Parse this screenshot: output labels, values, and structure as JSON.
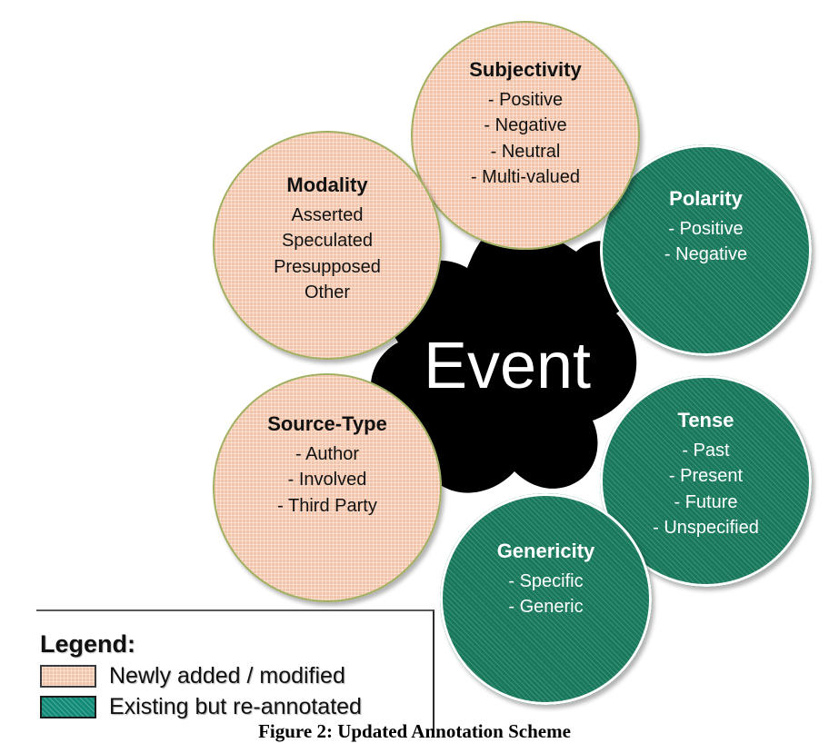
{
  "figure": {
    "center_label": "Event",
    "caption": "Figure 2: Updated Annotation Scheme"
  },
  "colors": {
    "pink_fill": "#f3c3a8",
    "pink_border": "#9fb161",
    "green_fill": "#18785c",
    "green_border": "#ffffff",
    "center_fill": "#000000",
    "center_text": "#ffffff",
    "legend_green_swatch": "#128a78"
  },
  "petals": [
    {
      "id": "subjectivity",
      "title": "Subjectivity",
      "category": "Newly added / modified",
      "items": [
        "- Positive",
        "- Negative",
        "- Neutral",
        "- Multi-valued"
      ]
    },
    {
      "id": "modality",
      "title": "Modality",
      "category": "Newly added / modified",
      "items": [
        "Asserted",
        "Speculated",
        "Presupposed",
        "Other"
      ]
    },
    {
      "id": "polarity",
      "title": "Polarity",
      "category": "Existing but re-annotated",
      "items": [
        "- Positive",
        "- Negative"
      ]
    },
    {
      "id": "tense",
      "title": "Tense",
      "category": "Existing but re-annotated",
      "items": [
        "- Past",
        "- Present",
        "- Future",
        "- Unspecified"
      ]
    },
    {
      "id": "genericity",
      "title": "Genericity",
      "category": "Existing but re-annotated",
      "items": [
        "- Specific",
        "- Generic"
      ]
    },
    {
      "id": "sourcetype",
      "title": "Source-Type",
      "category": "Newly added / modified",
      "items": [
        "- Author",
        "- Involved",
        "- Third Party"
      ]
    }
  ],
  "legend": {
    "title": "Legend:",
    "entries": [
      {
        "swatch": "pink-checkered-swatch",
        "label": "Newly added / modified"
      },
      {
        "swatch": "green-hatched-swatch",
        "label": "Existing but re-annotated"
      }
    ]
  }
}
